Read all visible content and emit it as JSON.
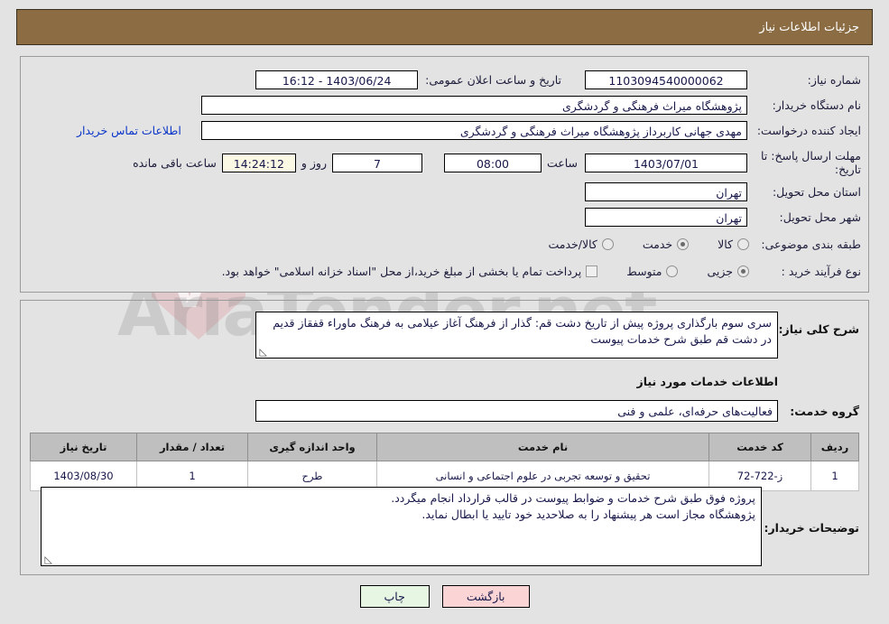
{
  "header": {
    "title": "جزئیات اطلاعات نیاز"
  },
  "watermark": {
    "text": "AriaTender.net"
  },
  "form": {
    "need_number": {
      "label": "شماره نیاز:",
      "value": "1103094540000062"
    },
    "announce_datetime": {
      "label": "تاریخ و ساعت اعلان عمومی:",
      "value": "1403/06/24 - 16:12"
    },
    "buyer_org": {
      "label": "نام دستگاه خریدار:",
      "value": "پژوهشگاه میراث فرهنگی و گردشگری"
    },
    "requester": {
      "label": "ایجاد کننده درخواست:",
      "value": "مهدی جهانی کاربرداز پژوهشگاه میراث فرهنگی و گردشگری"
    },
    "contact_link": "اطلاعات تماس خریدار",
    "deadline": {
      "label": "مهلت ارسال پاسخ: تا تاریخ:",
      "date": "1403/07/01",
      "time_label": "ساعت",
      "time": "08:00",
      "days": "7",
      "days_label": "روز و",
      "remaining": "14:24:12",
      "remaining_label": "ساعت باقی مانده"
    },
    "province": {
      "label": "استان محل تحویل:",
      "value": "تهران"
    },
    "city": {
      "label": "شهر محل تحویل:",
      "value": "تهران"
    },
    "category": {
      "label": "طبقه بندی موضوعی:",
      "options": [
        {
          "label": "کالا",
          "selected": false
        },
        {
          "label": "خدمت",
          "selected": true
        },
        {
          "label": "کالا/خدمت",
          "selected": false
        }
      ]
    },
    "purchase_type": {
      "label": "نوع فرآیند خرید :",
      "options": [
        {
          "label": "جزیی",
          "selected": true
        },
        {
          "label": "متوسط",
          "selected": false
        }
      ],
      "checkbox_checked": false,
      "note": "پرداخت تمام یا بخشی از مبلغ خرید،از محل \"اسناد خزانه اسلامی\" خواهد بود."
    }
  },
  "description": {
    "label": "شرح کلی نیاز:",
    "value": "سری سوم بارگذاری پروژه پیش از تاریخ دشت قم: گذار از فرهنگ آغاز عیلامی به فرهنگ ماوراء قفقاز قدیم در دشت قم طبق شرح خدمات پیوست"
  },
  "services_section": {
    "title": "اطلاعات خدمات مورد نیاز",
    "service_group": {
      "label": "گروه خدمت:",
      "value": "فعالیت‌های حرفه‌ای، علمی و فنی"
    }
  },
  "table": {
    "columns": [
      "ردیف",
      "کد خدمت",
      "نام خدمت",
      "واحد اندازه گیری",
      "تعداد / مقدار",
      "تاریخ نیاز"
    ],
    "rows": [
      {
        "row_no": "1",
        "service_code": "ز-722-72",
        "service_name": "تحقیق و توسعه تجربی در علوم اجتماعی و انسانی",
        "unit": "طرح",
        "quantity": "1",
        "need_date": "1403/08/30"
      }
    ]
  },
  "buyer_notes": {
    "label": "توضیحات خریدار:",
    "line1": "پروژه فوق طبق شرح خدمات و ضوابط پیوست در قالب قرارداد انجام میگردد.",
    "line2": "پژوهشگاه مجاز است هر پیشنهاد را به صلاحدید خود تایید یا ابطال نماید."
  },
  "footer": {
    "back_label": "بازگشت",
    "print_label": "چاپ"
  },
  "colors": {
    "header_bg": "#8c6c43",
    "page_bg": "#e3e3e3",
    "link": "#0a35c8",
    "back_btn": "#fbd5d5",
    "print_btn": "#e6f6e3",
    "table_header": "#bfbfbf"
  }
}
